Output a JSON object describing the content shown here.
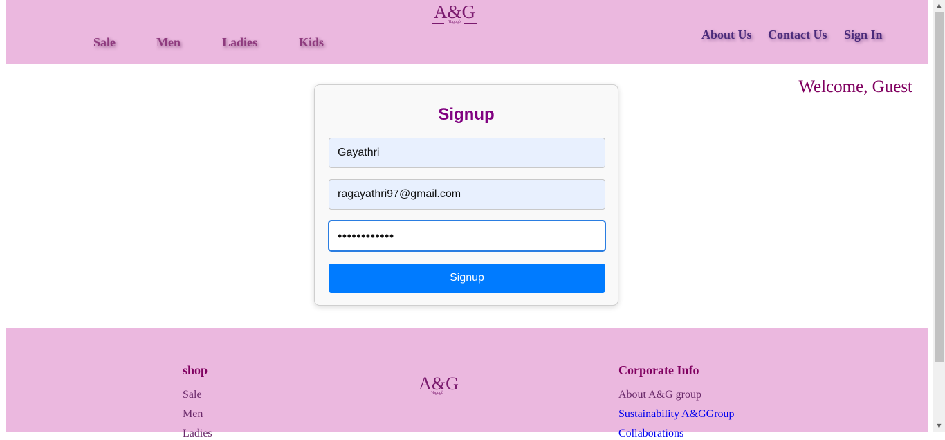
{
  "header": {
    "logo_text": "A&G",
    "logo_sub": "Vagagb",
    "nav_left": [
      "Sale",
      "Men",
      "Ladies",
      "Kids"
    ],
    "nav_right": [
      "About Us",
      "Contact Us",
      "Sign In"
    ]
  },
  "welcome_text": "Welcome, Guest",
  "signup": {
    "title": "Signup",
    "name_value": "Gayathri",
    "email_value": "ragayathri97@gmail.com",
    "password_masked": "••••••••••••",
    "button_label": "Signup"
  },
  "footer": {
    "shop_heading": "shop",
    "shop_links": [
      "Sale",
      "Men",
      "Ladies"
    ],
    "logo_text": "A&G",
    "logo_sub": "Vagagb",
    "corporate_heading": "Corporate Info",
    "corporate_links": [
      "About A&G group",
      "Sustainability A&GGroup",
      "Collaborations"
    ]
  },
  "colors": {
    "header_bg": "#ebb8df",
    "accent_purple": "#800080",
    "button_blue": "#007bff",
    "link_blue": "#0000ee"
  },
  "icons": {
    "scroll_up": "triangle-up-icon",
    "scroll_down": "triangle-down-icon"
  }
}
